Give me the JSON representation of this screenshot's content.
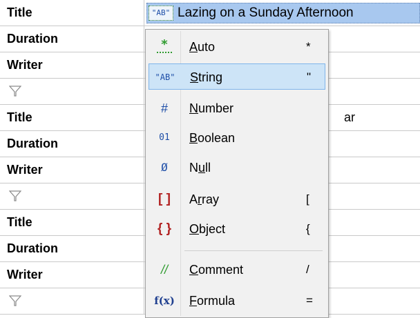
{
  "grid": {
    "rows": [
      {
        "key": "Title"
      },
      {
        "key": "Duration"
      },
      {
        "key": "Writer"
      },
      {
        "key": ""
      },
      {
        "key": "Title"
      },
      {
        "key": "Duration"
      },
      {
        "key": "Writer"
      },
      {
        "key": ""
      },
      {
        "key": "Title"
      },
      {
        "key": "Duration"
      },
      {
        "key": "Writer"
      },
      {
        "key": ""
      }
    ],
    "selected_value": "Lazing on a Sunday Afternoon",
    "selected_type_badge": "\"AB\"",
    "obscured_value_tail": "ar",
    "add_row_icon": "funnel-icon"
  },
  "menu": {
    "items": [
      {
        "icon": "*",
        "icon_name": "auto-icon",
        "label_pre": "",
        "label_u": "A",
        "label_post": "uto",
        "shortcut": "*",
        "icon_color": "#2e9b2e"
      },
      {
        "icon": "\"AB\"",
        "icon_name": "string-icon",
        "label_pre": "",
        "label_u": "S",
        "label_post": "tring",
        "shortcut": "\"",
        "icon_color": "#1f4fa8",
        "active": true
      },
      {
        "icon": "#",
        "icon_name": "number-icon",
        "label_pre": "",
        "label_u": "N",
        "label_post": "umber",
        "shortcut": "",
        "icon_color": "#1f4fa8"
      },
      {
        "icon": "01",
        "icon_name": "boolean-icon",
        "label_pre": "",
        "label_u": "B",
        "label_post": "oolean",
        "shortcut": "",
        "icon_color": "#1f4fa8"
      },
      {
        "icon": "Ø",
        "icon_name": "null-icon",
        "label_pre": "N",
        "label_u": "u",
        "label_post": "ll",
        "shortcut": "",
        "icon_color": "#1f4fa8"
      },
      {
        "icon": "[ ]",
        "icon_name": "array-icon",
        "label_pre": "A",
        "label_u": "r",
        "label_post": "ray",
        "shortcut": "[",
        "icon_color": "#b22222"
      },
      {
        "icon": "{ }",
        "icon_name": "object-icon",
        "label_pre": "",
        "label_u": "O",
        "label_post": "bject",
        "shortcut": "{",
        "icon_color": "#b22222"
      },
      {
        "icon": "//",
        "icon_name": "comment-icon",
        "label_pre": "",
        "label_u": "C",
        "label_post": "omment",
        "shortcut": "/",
        "icon_color": "#2e9b2e"
      },
      {
        "icon": "f(x)",
        "icon_name": "formula-icon",
        "label_pre": "",
        "label_u": "F",
        "label_post": "ormula",
        "shortcut": "=",
        "icon_color": "#1f3f8f"
      }
    ]
  },
  "colors": {
    "selection_bg": "#a8c8ef",
    "menu_bg": "#f1f1f1",
    "menu_active_bg": "#cde4f7",
    "menu_active_border": "#7eb4ea"
  }
}
